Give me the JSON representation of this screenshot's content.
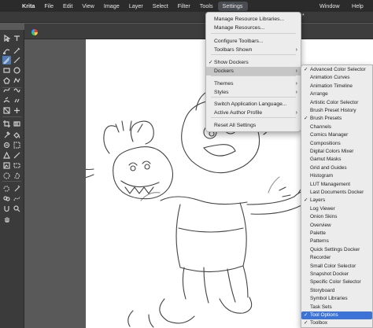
{
  "menubar": {
    "app": "Krita",
    "items": [
      "File",
      "Edit",
      "View",
      "Image",
      "Layer",
      "Select",
      "Filter",
      "Tools",
      "Settings"
    ],
    "active": "Settings",
    "window": "Window",
    "help": "Help"
  },
  "titlebar": {
    "title_suffix": "*"
  },
  "settings_menu": {
    "items": [
      {
        "label": "Manage Resource Libraries...",
        "check": false,
        "submenu": false
      },
      {
        "label": "Manage Resources...",
        "check": false,
        "submenu": false
      },
      {
        "label": "Configure Toolbars...",
        "check": false,
        "submenu": false
      },
      {
        "label": "Toolbars Shown",
        "check": false,
        "submenu": true
      },
      {
        "label": "Show Dockers",
        "check": true,
        "submenu": false
      },
      {
        "label": "Dockers",
        "check": false,
        "submenu": true,
        "highlighted": true
      },
      {
        "label": "Themes",
        "check": false,
        "submenu": true
      },
      {
        "label": "Styles",
        "check": false,
        "submenu": true
      },
      {
        "label": "Switch Application Language...",
        "check": false,
        "submenu": false
      },
      {
        "label": "Active Author Profile",
        "check": false,
        "submenu": true
      },
      {
        "label": "Reset All Settings",
        "check": false,
        "submenu": false
      }
    ]
  },
  "dockers_menu": {
    "items": [
      {
        "label": "Advanced Color Selector",
        "check": true
      },
      {
        "label": "Animation Curves",
        "check": false
      },
      {
        "label": "Animation Timeline",
        "check": false
      },
      {
        "label": "Arrange",
        "check": false
      },
      {
        "label": "Artistic Color Selector",
        "check": false
      },
      {
        "label": "Brush Preset History",
        "check": false
      },
      {
        "label": "Brush Presets",
        "check": true
      },
      {
        "label": "Channels",
        "check": false
      },
      {
        "label": "Comics Manager",
        "check": false
      },
      {
        "label": "Compositions",
        "check": false
      },
      {
        "label": "Digital Colors Mixer",
        "check": false
      },
      {
        "label": "Gamut Masks",
        "check": false
      },
      {
        "label": "Grid and Guides",
        "check": false
      },
      {
        "label": "Histogram",
        "check": false
      },
      {
        "label": "LUT Management",
        "check": false
      },
      {
        "label": "Last Documents Docker",
        "check": false
      },
      {
        "label": "Layers",
        "check": true
      },
      {
        "label": "Log Viewer",
        "check": false
      },
      {
        "label": "Onion Skins",
        "check": false
      },
      {
        "label": "Overview",
        "check": false
      },
      {
        "label": "Palette",
        "check": false
      },
      {
        "label": "Patterns",
        "check": false
      },
      {
        "label": "Quick Settings Docker",
        "check": false
      },
      {
        "label": "Recorder",
        "check": false
      },
      {
        "label": "Small Color Selector",
        "check": false
      },
      {
        "label": "Snapshot Docker",
        "check": false
      },
      {
        "label": "Specific Color Selector",
        "check": false
      },
      {
        "label": "Storyboard",
        "check": false
      },
      {
        "label": "Symbol Libraries",
        "check": false
      },
      {
        "label": "Task Sets",
        "check": false
      },
      {
        "label": "Tool Options",
        "check": true,
        "highlighted": true
      },
      {
        "label": "Toolbox",
        "check": true
      }
    ]
  },
  "toolbox": {
    "tools": [
      "select-shapes-icon",
      "text-icon",
      "edit-shapes-icon",
      "calligraphy-icon",
      "freehand-brush-icon",
      "line-icon",
      "rectangle-icon",
      "ellipse-icon",
      "polygon-icon",
      "polyline-icon",
      "bezier-curve-icon",
      "freehand-path-icon",
      "dynamic-brush-icon",
      "multibrush-icon",
      "transform-icon",
      "move-icon",
      "crop-icon",
      "gradient-icon",
      "color-sampler-icon",
      "fill-icon",
      "smart-patch-icon",
      "enclose-fill-icon",
      "assistant-icon",
      "measure-icon",
      "reference-image-icon",
      "rect-select-icon",
      "ellipse-select-icon",
      "polygon-select-icon",
      "freehand-select-icon",
      "contiguous-select-icon",
      "similar-select-icon",
      "bezier-select-icon",
      "magnetic-select-icon",
      "zoom-icon",
      "pan-icon"
    ],
    "selected": "freehand-brush-icon"
  },
  "colors": {
    "menubar": "#2b2b2b",
    "menu_bg": "#ececec",
    "highlight": "#3c73d6",
    "selected_tool": "#4e7bb5"
  }
}
